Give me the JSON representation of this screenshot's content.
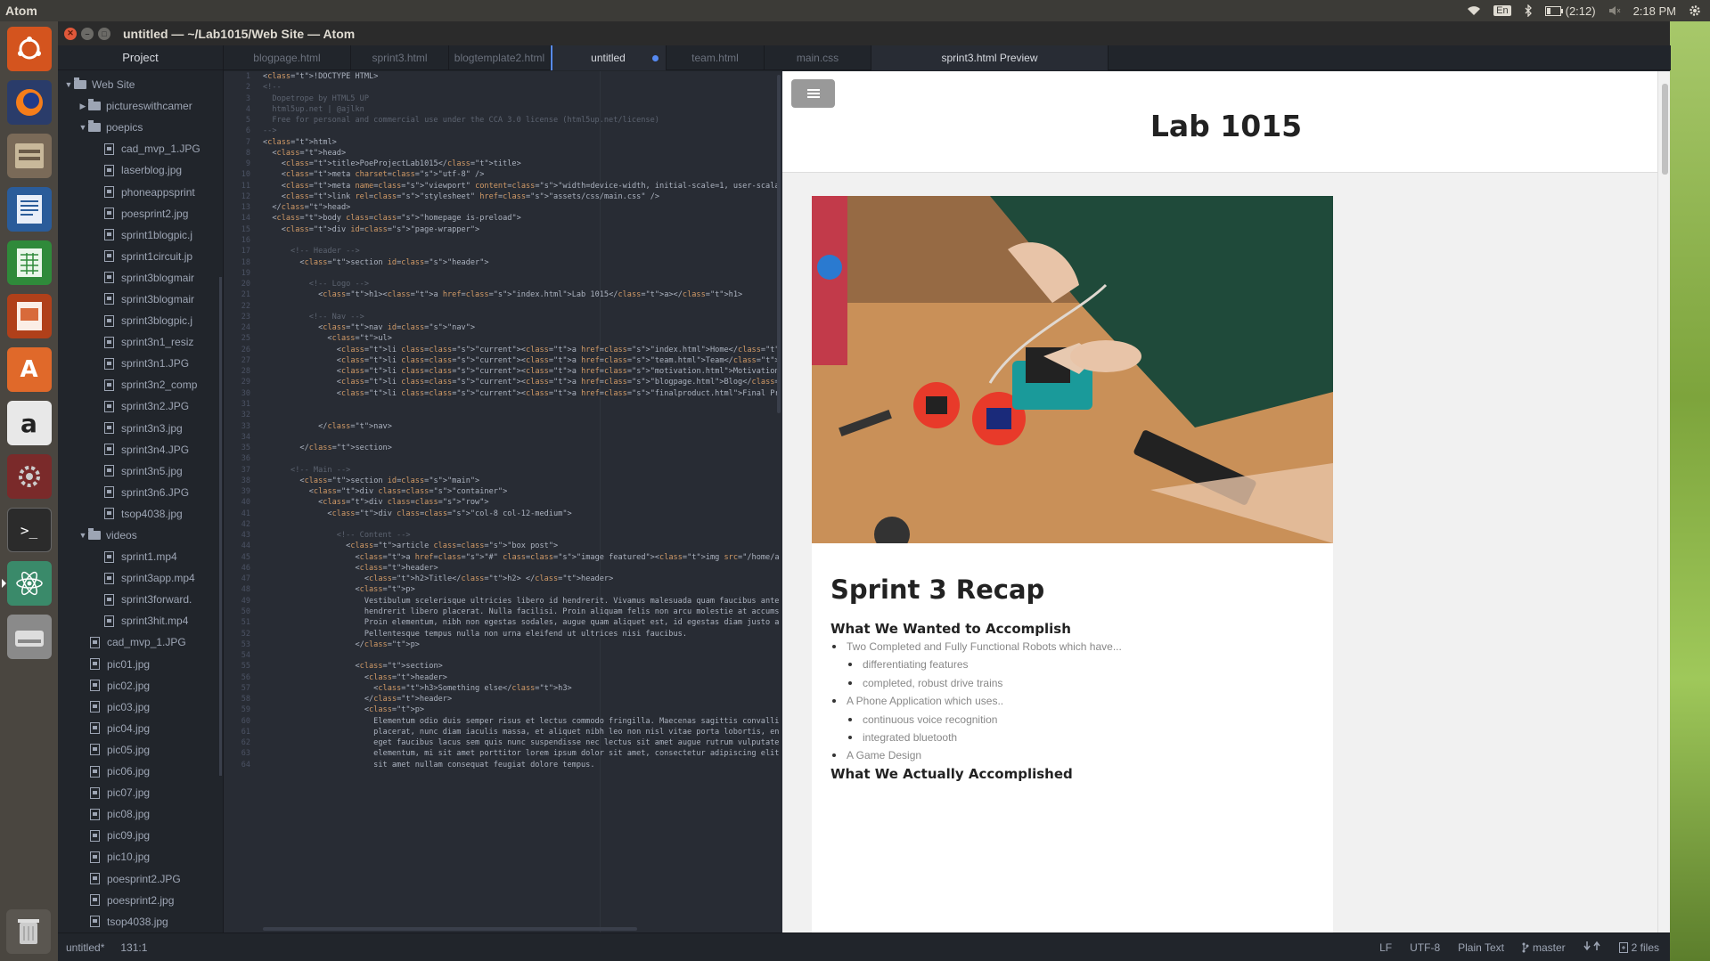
{
  "system_bar": {
    "app_name": "Atom",
    "keyboard": "En",
    "battery": "(2:12)",
    "clock": "2:18 PM"
  },
  "window": {
    "title": "untitled — ~/Lab1015/Web Site — Atom"
  },
  "tree": {
    "header": "Project",
    "items": [
      {
        "label": "Web Site",
        "type": "folder",
        "depth": 0,
        "open": true
      },
      {
        "label": "pictureswithcamer",
        "type": "folder",
        "depth": 1,
        "open": false
      },
      {
        "label": "poepics",
        "type": "folder",
        "depth": 1,
        "open": true
      },
      {
        "label": "cad_mvp_1.JPG",
        "type": "file",
        "depth": 2
      },
      {
        "label": "laserblog.jpg",
        "type": "file",
        "depth": 2
      },
      {
        "label": "phoneappsprint",
        "type": "file",
        "depth": 2
      },
      {
        "label": "poesprint2.jpg",
        "type": "file",
        "depth": 2
      },
      {
        "label": "sprint1blogpic.j",
        "type": "file",
        "depth": 2
      },
      {
        "label": "sprint1circuit.jp",
        "type": "file",
        "depth": 2
      },
      {
        "label": "sprint3blogmair",
        "type": "file",
        "depth": 2
      },
      {
        "label": "sprint3blogmair",
        "type": "file",
        "depth": 2
      },
      {
        "label": "sprint3blogpic.j",
        "type": "file",
        "depth": 2
      },
      {
        "label": "sprint3n1_resiz",
        "type": "file",
        "depth": 2
      },
      {
        "label": "sprint3n1.JPG",
        "type": "file",
        "depth": 2
      },
      {
        "label": "sprint3n2_comp",
        "type": "file",
        "depth": 2
      },
      {
        "label": "sprint3n2.JPG",
        "type": "file",
        "depth": 2
      },
      {
        "label": "sprint3n3.jpg",
        "type": "file",
        "depth": 2
      },
      {
        "label": "sprint3n4.JPG",
        "type": "file",
        "depth": 2
      },
      {
        "label": "sprint3n5.jpg",
        "type": "file",
        "depth": 2
      },
      {
        "label": "sprint3n6.JPG",
        "type": "file",
        "depth": 2
      },
      {
        "label": "tsop4038.jpg",
        "type": "file",
        "depth": 2
      },
      {
        "label": "videos",
        "type": "folder",
        "depth": 1,
        "open": true
      },
      {
        "label": "sprint1.mp4",
        "type": "file",
        "depth": 2
      },
      {
        "label": "sprint3app.mp4",
        "type": "file",
        "depth": 2
      },
      {
        "label": "sprint3forward.",
        "type": "file",
        "depth": 2
      },
      {
        "label": "sprint3hit.mp4",
        "type": "file",
        "depth": 2
      },
      {
        "label": "cad_mvp_1.JPG",
        "type": "file",
        "depth": 1
      },
      {
        "label": "pic01.jpg",
        "type": "file",
        "depth": 1
      },
      {
        "label": "pic02.jpg",
        "type": "file",
        "depth": 1
      },
      {
        "label": "pic03.jpg",
        "type": "file",
        "depth": 1
      },
      {
        "label": "pic04.jpg",
        "type": "file",
        "depth": 1
      },
      {
        "label": "pic05.jpg",
        "type": "file",
        "depth": 1
      },
      {
        "label": "pic06.jpg",
        "type": "file",
        "depth": 1
      },
      {
        "label": "pic07.jpg",
        "type": "file",
        "depth": 1
      },
      {
        "label": "pic08.jpg",
        "type": "file",
        "depth": 1
      },
      {
        "label": "pic09.jpg",
        "type": "file",
        "depth": 1
      },
      {
        "label": "pic10.jpg",
        "type": "file",
        "depth": 1
      },
      {
        "label": "poesprint2.JPG",
        "type": "file",
        "depth": 1
      },
      {
        "label": "poesprint2.jpg",
        "type": "file",
        "depth": 1
      },
      {
        "label": "tsop4038.jpg",
        "type": "file",
        "depth": 1
      }
    ]
  },
  "tabs": [
    {
      "label": "blogpage.html",
      "active": false,
      "modified": false
    },
    {
      "label": "sprint3.html",
      "active": false,
      "modified": false
    },
    {
      "label": "blogtemplate2.html",
      "active": false,
      "modified": false
    },
    {
      "label": "untitled",
      "active": true,
      "modified": true
    },
    {
      "label": "team.html",
      "active": false,
      "modified": false
    },
    {
      "label": "main.css",
      "active": false,
      "modified": false
    },
    {
      "label": "sprint3.html Preview",
      "active": false,
      "modified": false,
      "preview": true
    }
  ],
  "editor": {
    "lines": [
      "<!DOCTYPE HTML>",
      "<!--",
      "  Dopetrope by HTML5 UP",
      "  html5up.net | @ajlkn",
      "  Free for personal and commercial use under the CCA 3.0 license (html5up.net/license)",
      "-->",
      "<html>",
      "  <head>",
      "    <title>PoeProjectLab1015</title>",
      "    <meta charset=\"utf-8\" />",
      "    <meta name=\"viewport\" content=\"width=device-width, initial-scale=1, user-scalable=no\" />",
      "    <link rel=\"stylesheet\" href=\"assets/css/main.css\" />",
      "  </head>",
      "  <body class=\"homepage is-preload\">",
      "    <div id=\"page-wrapper\">",
      "",
      "      <!-- Header -->",
      "        <section id=\"header\">",
      "",
      "          <!-- Logo -->",
      "            <h1><a href=\"index.html\">Lab 1015</a></h1>",
      "",
      "          <!-- Nav -->",
      "            <nav id=\"nav\">",
      "              <ul>",
      "                <li class=\"current\"><a href=\"index.html\">Home</a></li>",
      "                <li class=\"current\"><a href=\"team.html\">Team</a></li>",
      "                <li class=\"current\"><a href=\"motivation.html\">Motivation</a></li>",
      "                <li class=\"current\"><a href=\"blogpage.html\">Blog</a></li>",
      "                <li class=\"current\"><a href=\"finalproduct.html\">Final Product</a></li>",
      "",
      "",
      "            </nav>",
      "",
      "        </section>",
      "",
      "      <!-- Main -->",
      "        <section id=\"main\">",
      "          <div class=\"container\">",
      "            <div class=\"row\">",
      "              <div class=\"col-8 col-12-medium\">",
      "",
      "                <!-- Content -->",
      "                  <article class=\"box post\">",
      "                    <a href=\"#\" class=\"image featured\"><img src=\"/home/allison/Lab1015/Web Site/images/groupphotos/groupPic.jpe",
      "                    <header>",
      "                      <h2>Title</h2> </header>",
      "                    <p>",
      "                      Vestibulum scelerisque ultricies libero id hendrerit. Vivamus malesuada quam faucibus ante dignissim auct",
      "                      hendrerit libero placerat. Nulla facilisi. Proin aliquam felis non arcu molestie at accumsan turpis commo",
      "                      Proin elementum, nibh non egestas sodales, augue quam aliquet est, id egestas diam justo adipiscing ante.",
      "                      Pellentesque tempus nulla non urna eleifend ut ultrices nisi faucibus.",
      "                    </p>",
      "",
      "                    <section>",
      "                      <header>",
      "                        <h3>Something else</h3>",
      "                      </header>",
      "                      <p>",
      "                        Elementum odio duis semper risus et lectus commodo fringilla. Maecenas sagittis convallis justo vel mat",
      "                        placerat, nunc diam iaculis massa, et aliquet nibh leo non nisl vitae porta lobortis, enim neque fringi",
      "                        eget faucibus lacus sem quis nunc suspendisse nec lectus sit amet augue rutrum vulputate ut ut mi. Aene",
      "                        elementum, mi sit amet porttitor lorem ipsum dolor sit amet, consectetur adipiscing elit. Lorem ipsum d",
      "                        sit amet nullam consequat feugiat dolore tempus."
    ]
  },
  "preview": {
    "site_title": "Lab 1015",
    "post_title": "Sprint 3 Recap",
    "section1_title": "What We Wanted to Accomplish",
    "list": [
      {
        "text": "Two Completed and Fully Functional Robots which have...",
        "sub": false
      },
      {
        "text": "differentiating features",
        "sub": true
      },
      {
        "text": "completed, robust drive trains",
        "sub": true
      },
      {
        "text": "A Phone Application which uses..",
        "sub": false
      },
      {
        "text": "continuous voice recognition",
        "sub": true
      },
      {
        "text": "integrated bluetooth",
        "sub": true
      },
      {
        "text": "A Game Design",
        "sub": false
      }
    ],
    "section2_title": "What We Actually Accomplished"
  },
  "status_bar": {
    "file": "untitled*",
    "cursor": "131:1",
    "line_ending": "LF",
    "encoding": "UTF-8",
    "grammar": "Plain Text",
    "branch": "master",
    "files": "2 files"
  }
}
